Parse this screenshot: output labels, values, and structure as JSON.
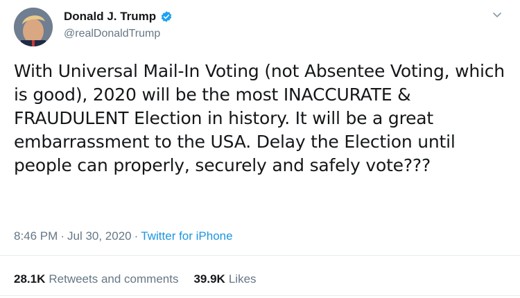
{
  "user": {
    "display_name": "Donald J. Trump",
    "handle": "@realDonaldTrump",
    "verified": true
  },
  "icons": {
    "verified": "verified-badge-icon",
    "menu": "chevron-down-icon",
    "avatar": "profile-photo"
  },
  "tweet": {
    "text": "With Universal Mail-In Voting (not Absentee Voting, which is good), 2020 will be the most INACCURATE & FRAUDULENT Election in history. It will be a great embarrassment to the USA. Delay the Election until people can properly, securely and safely vote???",
    "time": "8:46 PM",
    "date": "Jul 30, 2020",
    "separator": "·",
    "source": "Twitter for iPhone"
  },
  "stats": {
    "retweets_count": "28.1K",
    "retweets_label": "Retweets and comments",
    "likes_count": "39.9K",
    "likes_label": "Likes"
  },
  "colors": {
    "text": "#14171a",
    "muted": "#657786",
    "link": "#1b95e0",
    "verified": "#1da1f2",
    "divider": "#e6ecf0"
  }
}
